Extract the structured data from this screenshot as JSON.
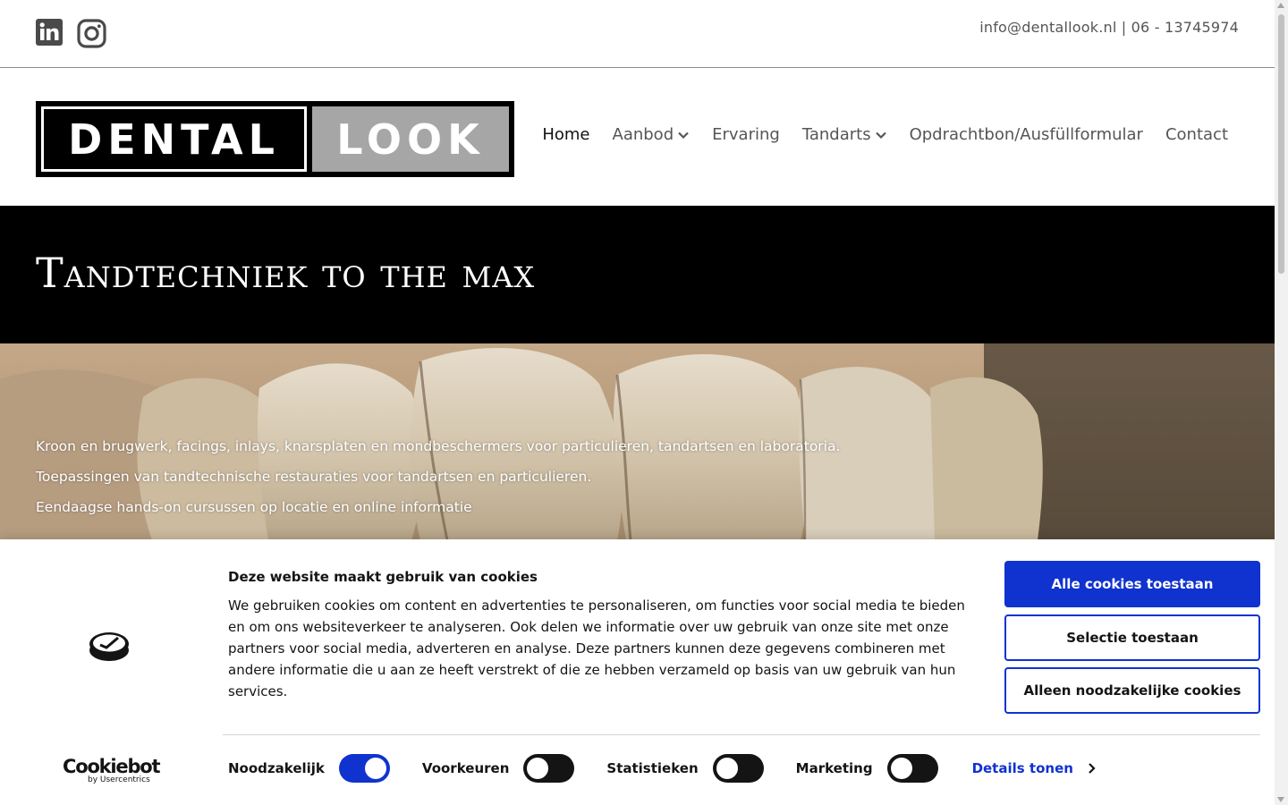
{
  "topbar": {
    "social": [
      {
        "name": "linkedin-icon"
      },
      {
        "name": "instagram-icon"
      }
    ],
    "email": "info@dentallook.nl",
    "separator": "|",
    "phone": "06 - 13745974"
  },
  "header": {
    "logo_left": "DENTAL",
    "logo_right": "LOOK",
    "nav": [
      {
        "label": "Home",
        "active": true,
        "dropdown": false
      },
      {
        "label": "Aanbod",
        "active": false,
        "dropdown": true
      },
      {
        "label": "Ervaring",
        "active": false,
        "dropdown": false
      },
      {
        "label": "Tandarts",
        "active": false,
        "dropdown": true
      },
      {
        "label": "Opdrachtbon/Ausfüllformular",
        "active": false,
        "dropdown": false
      },
      {
        "label": "Contact",
        "active": false,
        "dropdown": false
      }
    ]
  },
  "hero": {
    "title": "Tandtechniek to the max",
    "lines": [
      "Kroon en brugwerk, facings, inlays, knarsplaten en mondbeschermers voor particulieren, tandartsen en laboratoria.",
      "Toepassingen van tandtechnische restauraties voor tandartsen en particulieren.",
      "Eendaagse hands-on cursussen op locatie en online informatie"
    ]
  },
  "cookie": {
    "title": "Deze website maakt gebruik van cookies",
    "text": "We gebruiken cookies om content en advertenties te personaliseren, om functies voor social media te bieden en om ons websiteverkeer te analyseren. Ook delen we informatie over uw gebruik van onze site met onze partners voor social media, adverteren en analyse. Deze partners kunnen deze gegevens combineren met andere informatie die u aan ze heeft verstrekt of die ze hebben verzameld op basis van uw gebruik van hun services.",
    "buttons": {
      "allow_all": "Alle cookies toestaan",
      "allow_selection": "Selectie toestaan",
      "necessary_only": "Alleen noodzakelijke cookies"
    },
    "toggles": [
      {
        "label": "Noodzakelijk",
        "on": true
      },
      {
        "label": "Voorkeuren",
        "on": false
      },
      {
        "label": "Statistieken",
        "on": false
      },
      {
        "label": "Marketing",
        "on": false
      }
    ],
    "details": "Details tonen",
    "brand_main": "Cookiebot",
    "brand_sub": "by Usercentrics",
    "accent": "#1032cf"
  }
}
